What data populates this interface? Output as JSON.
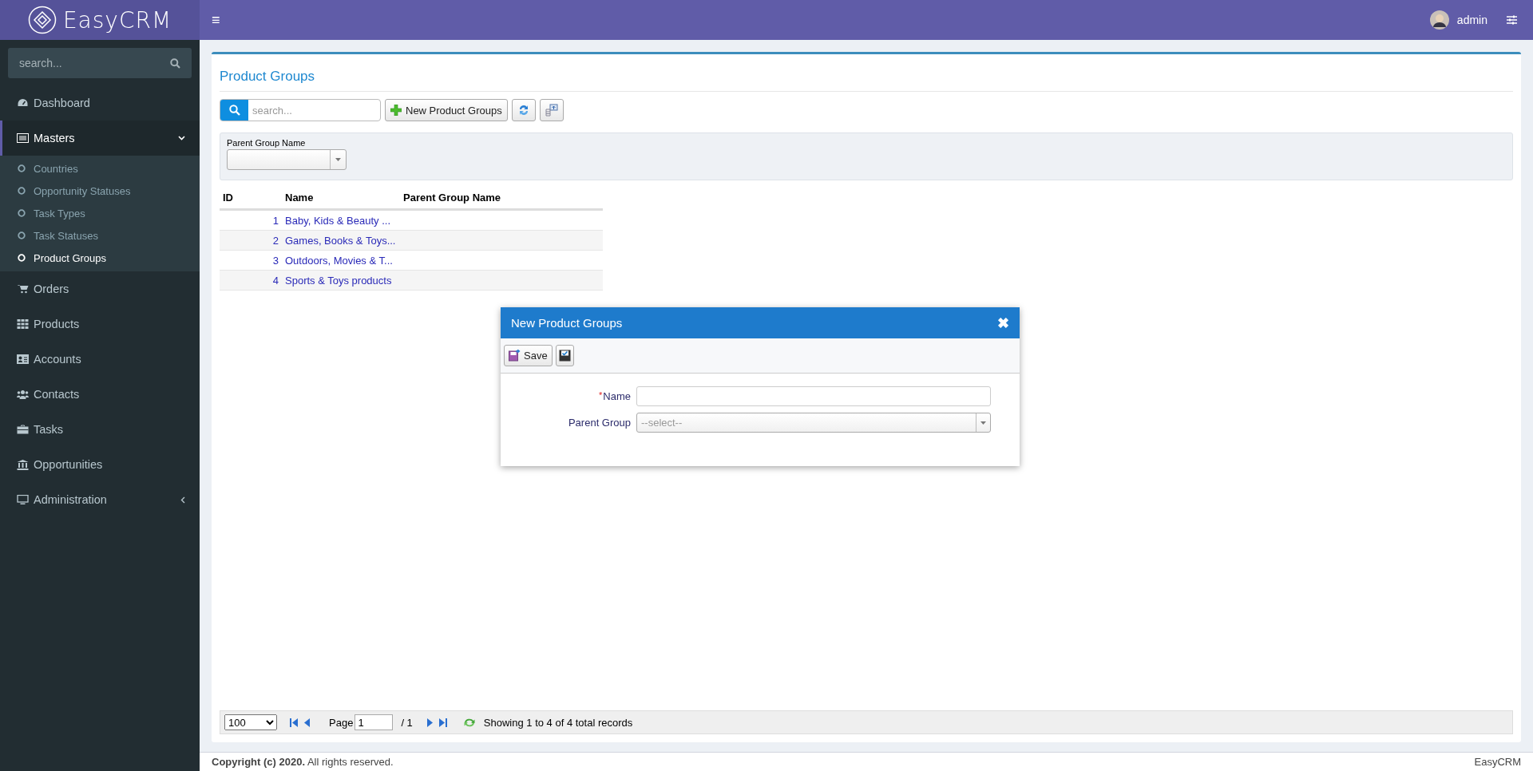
{
  "brand": {
    "logo": "EasyCRM"
  },
  "topbar": {
    "menu_glyph": "≡",
    "user": "admin"
  },
  "sidebar": {
    "search_placeholder": "search...",
    "items": [
      {
        "label": "Dashboard",
        "kind": "link",
        "selected": false
      },
      {
        "label": "Masters",
        "kind": "group",
        "expanded": true,
        "selected": true,
        "children": [
          {
            "label": "Countries",
            "selected": false
          },
          {
            "label": "Opportunity Statuses",
            "selected": false
          },
          {
            "label": "Task Types",
            "selected": false
          },
          {
            "label": "Task Statuses",
            "selected": false
          },
          {
            "label": "Product Groups",
            "selected": true
          }
        ]
      },
      {
        "label": "Orders",
        "kind": "link",
        "selected": false
      },
      {
        "label": "Products",
        "kind": "link",
        "selected": false
      },
      {
        "label": "Accounts",
        "kind": "link",
        "selected": false
      },
      {
        "label": "Contacts",
        "kind": "link",
        "selected": false
      },
      {
        "label": "Tasks",
        "kind": "link",
        "selected": false
      },
      {
        "label": "Opportunities",
        "kind": "link",
        "selected": false
      },
      {
        "label": "Administration",
        "kind": "group",
        "expanded": false,
        "selected": false
      }
    ]
  },
  "page": {
    "title": "Product Groups",
    "search_placeholder": "search...",
    "new_button": "New Product Groups",
    "filter": {
      "label": "Parent Group Name"
    },
    "table": {
      "columns": [
        "ID",
        "Name",
        "Parent Group Name"
      ],
      "rows": [
        {
          "id": "1",
          "name": "Baby, Kids & Beauty ..."
        },
        {
          "id": "2",
          "name": "Games, Books & Toys..."
        },
        {
          "id": "3",
          "name": "Outdoors, Movies & T..."
        },
        {
          "id": "4",
          "name": "Sports & Toys products"
        }
      ]
    },
    "pager": {
      "page_size": "100",
      "page_label": "Page",
      "page": "1",
      "total_pages": "/ 1",
      "status": "Showing 1 to 4 of 4 total records"
    }
  },
  "dialog": {
    "title": "New Product Groups",
    "required_mark": "*",
    "close_glyph": "✖",
    "save_button": "Save",
    "fields": [
      {
        "label": "Name",
        "kind": "text",
        "required": true
      },
      {
        "label": "Parent Group",
        "kind": "select",
        "required": false,
        "placeholder": "--select--"
      }
    ]
  },
  "footer": {
    "copyright": "**Copyright (c) 2020.** All rights reserved.",
    "brand": "EasyCRM"
  }
}
